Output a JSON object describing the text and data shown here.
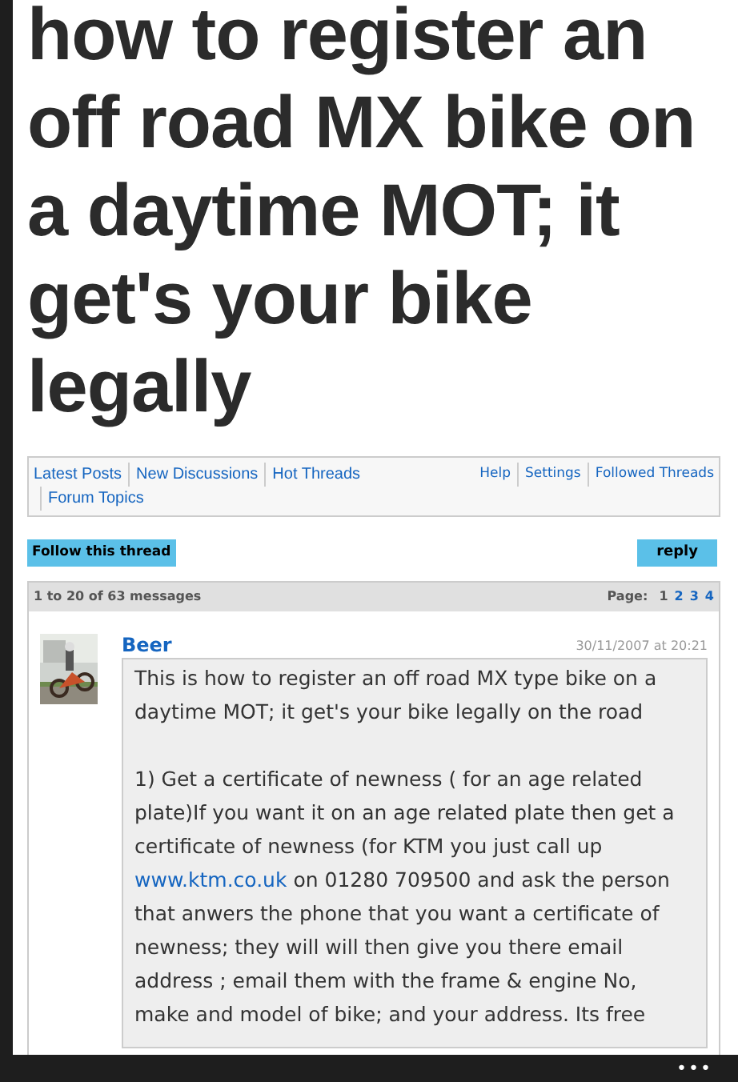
{
  "title": "how to register an off road MX bike on a daytime MOT; it get's your bike legally",
  "nav": {
    "left": [
      "Latest Posts",
      "New Discussions",
      "Hot Threads",
      "Forum Topics"
    ],
    "right": [
      "Help",
      "Settings",
      "Followed Threads"
    ]
  },
  "buttons": {
    "follow": "Follow this thread",
    "reply": "reply"
  },
  "summary": {
    "count": "1 to 20 of 63 messages",
    "page_label": "Page:",
    "pages": [
      {
        "label": "1",
        "selected": true
      },
      {
        "label": "2",
        "selected": false
      },
      {
        "label": "3",
        "selected": false
      },
      {
        "label": "4",
        "selected": false
      }
    ]
  },
  "post": {
    "author": "Beer",
    "date": "30/11/2007 at 20:21",
    "paragraphs": [
      {
        "text": "This is how to register an off road MX type bike on a daytime MOT; it get's your bike legally on the road"
      },
      {
        "before": "1) Get a certificate of newness ( for an age related plate)If you want it on an age related plate then get a certificate of newness (for KTM you just call up ",
        "link": "www.ktm.co.uk",
        "after": " on 01280 709500 and ask the person that anwers the phone that you want a certificate of newness; they will will then give you there email address ; email them with the frame & engine No, make and model of bike; and your address. Its free"
      }
    ]
  },
  "bottom_bar": {
    "menu": "•••"
  }
}
